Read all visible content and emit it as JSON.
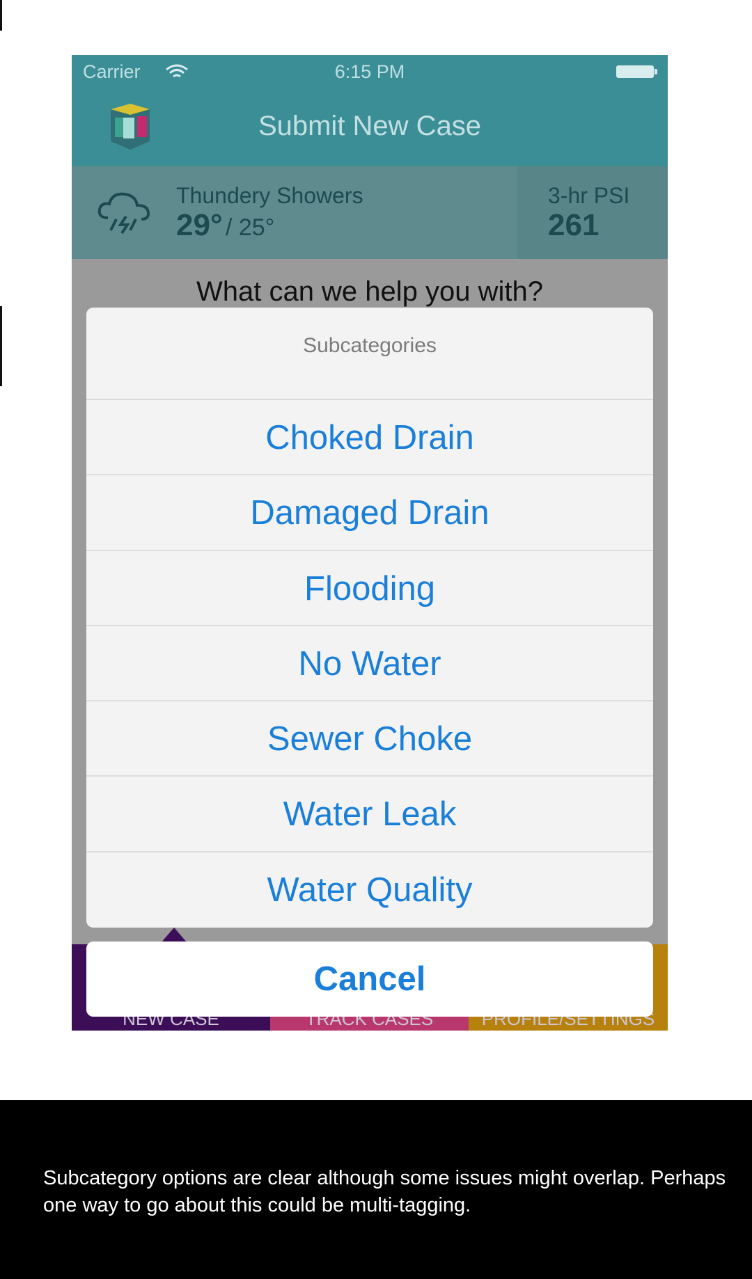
{
  "status_bar": {
    "carrier": "Carrier",
    "time": "6:15 PM"
  },
  "nav": {
    "title": "Submit New Case"
  },
  "weather": {
    "condition": "Thundery Showers",
    "high": "29°",
    "low": "/ 25°",
    "psi_label": "3-hr PSI",
    "psi_value": "261"
  },
  "prompt": "What can we help you with?",
  "action_sheet": {
    "title": "Subcategories",
    "options": [
      "Choked Drain",
      "Damaged Drain",
      "Flooding",
      "No Water",
      "Sewer Choke",
      "Water Leak",
      "Water Quality"
    ],
    "cancel_label": "Cancel"
  },
  "tabs": [
    "NEW CASE",
    "TRACK CASES",
    "PROFILE/SETTINGS"
  ],
  "colors": {
    "header": "#3c8e96",
    "tab_new": "#3b0e57",
    "tab_track": "#b8386e",
    "tab_profile": "#b6810d",
    "ios_blue": "#1a7fd9"
  },
  "caption": "Subcategory options are clear although some issues might overlap. Perhaps one way to go about this could be multi-tagging."
}
